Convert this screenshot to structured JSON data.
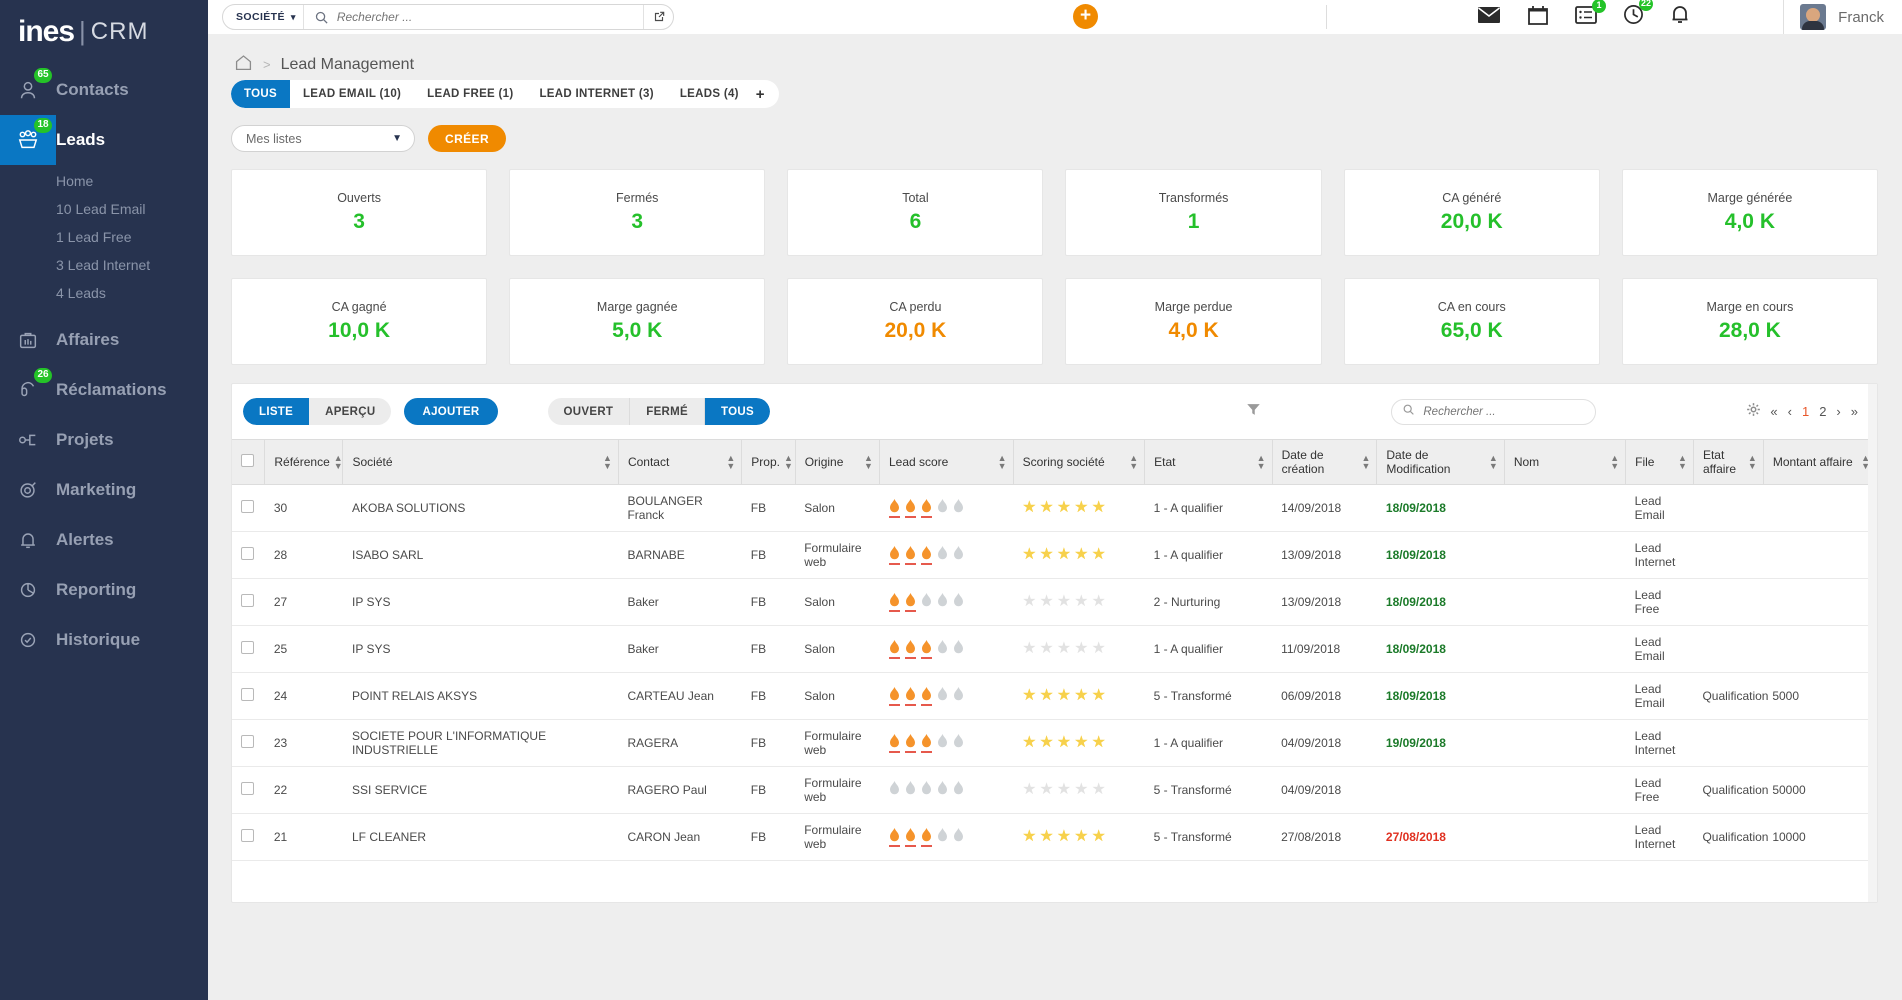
{
  "brand": {
    "name": "ines",
    "separator": "|",
    "suffix": "CRM"
  },
  "sidebar": {
    "items": [
      {
        "label": "Contacts",
        "icon": "person-icon",
        "badge": "65",
        "active": false
      },
      {
        "label": "Leads",
        "icon": "leads-icon",
        "badge": "18",
        "active": true
      },
      {
        "label": "Affaires",
        "icon": "briefcase-icon",
        "badge": "",
        "active": false
      },
      {
        "label": "Réclamations",
        "icon": "headset-icon",
        "badge": "26",
        "active": false
      },
      {
        "label": "Projets",
        "icon": "project-icon",
        "badge": "",
        "active": false
      },
      {
        "label": "Marketing",
        "icon": "target-icon",
        "badge": "",
        "active": false
      },
      {
        "label": "Alertes",
        "icon": "bell-icon",
        "badge": "",
        "active": false
      },
      {
        "label": "Reporting",
        "icon": "piechart-icon",
        "badge": "",
        "active": false
      },
      {
        "label": "Historique",
        "icon": "history-icon",
        "badge": "",
        "active": false
      }
    ],
    "subnav": [
      "Home",
      "10 Lead Email",
      "1 Lead Free",
      "3 Lead Internet",
      "4 Leads"
    ]
  },
  "topbar": {
    "search_scope": "SOCIÉTÉ",
    "search_placeholder": "Rechercher ...",
    "search_value": "",
    "search_icon": "search-icon",
    "external_link_icon": "external-link-icon",
    "add_button_icon": "plus-icon",
    "icons": [
      {
        "name": "mail-icon",
        "badge": ""
      },
      {
        "name": "calendar-icon",
        "badge": ""
      },
      {
        "name": "tasks-icon",
        "badge": "1"
      },
      {
        "name": "clock-icon",
        "badge": "22"
      },
      {
        "name": "bell-icon",
        "badge": ""
      }
    ],
    "user_name": "Franck",
    "avatar": "user-avatar"
  },
  "breadcrumb": {
    "home_icon": "home-icon",
    "separator": ">",
    "title": "Lead Management"
  },
  "tabs": [
    {
      "label": "TOUS",
      "active": true
    },
    {
      "label": "LEAD EMAIL (10)",
      "active": false
    },
    {
      "label": "LEAD FREE (1)",
      "active": false
    },
    {
      "label": "LEAD INTERNET (3)",
      "active": false
    },
    {
      "label": "LEADS (4)",
      "active": false
    }
  ],
  "tab_add_icon": "plus-icon",
  "listbar": {
    "select_value": "Mes listes",
    "select_caret_icon": "chevron-down-icon",
    "create_label": "CRÉER"
  },
  "kpis": [
    {
      "label": "Ouverts",
      "value": "3",
      "color": "green"
    },
    {
      "label": "Fermés",
      "value": "3",
      "color": "green"
    },
    {
      "label": "Total",
      "value": "6",
      "color": "green"
    },
    {
      "label": "Transformés",
      "value": "1",
      "color": "green"
    },
    {
      "label": "CA généré",
      "value": "20,0 K",
      "color": "green"
    },
    {
      "label": "Marge générée",
      "value": "4,0 K",
      "color": "green"
    },
    {
      "label": "CA gagné",
      "value": "10,0 K",
      "color": "green"
    },
    {
      "label": "Marge gagnée",
      "value": "5,0 K",
      "color": "green"
    },
    {
      "label": "CA perdu",
      "value": "20,0 K",
      "color": "orange"
    },
    {
      "label": "Marge perdue",
      "value": "4,0 K",
      "color": "orange"
    },
    {
      "label": "CA en cours",
      "value": "65,0 K",
      "color": "green"
    },
    {
      "label": "Marge en cours",
      "value": "28,0 K",
      "color": "green"
    }
  ],
  "panel_toolbar": {
    "view_modes": [
      {
        "label": "LISTE",
        "active": true
      },
      {
        "label": "APERÇU",
        "active": false
      }
    ],
    "add_label": "AJOUTER",
    "status_filters": [
      {
        "label": "OUVERT",
        "active": false
      },
      {
        "label": "FERMÉ",
        "active": false
      },
      {
        "label": "TOUS",
        "active": true
      }
    ],
    "filter_icon": "funnel-icon",
    "search_icon": "search-icon",
    "search_placeholder": "Rechercher ...",
    "search_value": "",
    "gear_icon": "gear-icon",
    "pagination": {
      "first": "«",
      "prev": "‹",
      "pages": [
        "1",
        "2"
      ],
      "current": "1",
      "next": "›",
      "last": "»"
    }
  },
  "table": {
    "select_all_checkbox": false,
    "columns": [
      {
        "label": "Référence",
        "sortable": true
      },
      {
        "label": "Société",
        "sortable": true
      },
      {
        "label": "Contact",
        "sortable": true
      },
      {
        "label": "Prop.",
        "sortable": true
      },
      {
        "label": "Origine",
        "sortable": true
      },
      {
        "label": "Lead score",
        "sortable": true
      },
      {
        "label": "Scoring société",
        "sortable": true
      },
      {
        "label": "Etat",
        "sortable": true
      },
      {
        "label": "Date de création",
        "sortable": true
      },
      {
        "label": "Date de Modification",
        "sortable": true
      },
      {
        "label": "Nom",
        "sortable": true
      },
      {
        "label": "File",
        "sortable": true
      },
      {
        "label": "Etat affaire",
        "sortable": true
      },
      {
        "label": "Montant affaire",
        "sortable": true
      }
    ],
    "rows": [
      {
        "reference": "30",
        "societe": "AKOBA SOLUTIONS",
        "contact": "BOULANGER Franck",
        "prop": "FB",
        "origine": "Salon",
        "lead_score": 3,
        "scoring_societe": 5,
        "etat": "1 - A qualifier",
        "date_creation": "14/09/2018",
        "date_modification": "18/09/2018",
        "date_modification_color": "green",
        "nom": "",
        "file": "Lead Email",
        "etat_affaire": "",
        "montant_affaire": ""
      },
      {
        "reference": "28",
        "societe": "ISABO SARL",
        "contact": "BARNABE",
        "prop": "FB",
        "origine": "Formulaire web",
        "lead_score": 3,
        "scoring_societe": 5,
        "etat": "1 - A qualifier",
        "date_creation": "13/09/2018",
        "date_modification": "18/09/2018",
        "date_modification_color": "green",
        "nom": "",
        "file": "Lead Internet",
        "etat_affaire": "",
        "montant_affaire": ""
      },
      {
        "reference": "27",
        "societe": "IP SYS",
        "contact": "Baker",
        "prop": "FB",
        "origine": "Salon",
        "lead_score": 2,
        "scoring_societe": 0,
        "etat": "2 - Nurturing",
        "date_creation": "13/09/2018",
        "date_modification": "18/09/2018",
        "date_modification_color": "green",
        "nom": "",
        "file": "Lead Free",
        "etat_affaire": "",
        "montant_affaire": ""
      },
      {
        "reference": "25",
        "societe": "IP SYS",
        "contact": "Baker",
        "prop": "FB",
        "origine": "Salon",
        "lead_score": 3,
        "scoring_societe": 0,
        "etat": "1 - A qualifier",
        "date_creation": "11/09/2018",
        "date_modification": "18/09/2018",
        "date_modification_color": "green",
        "nom": "",
        "file": "Lead Email",
        "etat_affaire": "",
        "montant_affaire": ""
      },
      {
        "reference": "24",
        "societe": "POINT RELAIS AKSYS",
        "contact": "CARTEAU Jean",
        "prop": "FB",
        "origine": "Salon",
        "lead_score": 3,
        "scoring_societe": 5,
        "etat": "5 - Transformé",
        "date_creation": "06/09/2018",
        "date_modification": "18/09/2018",
        "date_modification_color": "green",
        "nom": "",
        "file": "Lead Email",
        "etat_affaire": "Qualification",
        "montant_affaire": "5000"
      },
      {
        "reference": "23",
        "societe": "SOCIETE POUR L'INFORMATIQUE INDUSTRIELLE",
        "contact": "RAGERA",
        "prop": "FB",
        "origine": "Formulaire web",
        "lead_score": 3,
        "scoring_societe": 5,
        "etat": "1 - A qualifier",
        "date_creation": "04/09/2018",
        "date_modification": "19/09/2018",
        "date_modification_color": "green",
        "nom": "",
        "file": "Lead Internet",
        "etat_affaire": "",
        "montant_affaire": ""
      },
      {
        "reference": "22",
        "societe": "SSI SERVICE",
        "contact": "RAGERO Paul",
        "prop": "FB",
        "origine": "Formulaire web",
        "lead_score": 0,
        "scoring_societe": 0,
        "etat": "5 - Transformé",
        "date_creation": "04/09/2018",
        "date_modification": "",
        "date_modification_color": "green",
        "nom": "",
        "file": "Lead Free",
        "etat_affaire": "Qualification",
        "montant_affaire": "50000"
      },
      {
        "reference": "21",
        "societe": "LF CLEANER",
        "contact": "CARON Jean",
        "prop": "FB",
        "origine": "Formulaire web",
        "lead_score": 3,
        "scoring_societe": 5,
        "etat": "5 - Transformé",
        "date_creation": "27/08/2018",
        "date_modification": "27/08/2018",
        "date_modification_color": "red",
        "nom": "",
        "file": "Lead Internet",
        "etat_affaire": "Qualification",
        "montant_affaire": "10000"
      }
    ]
  },
  "colors": {
    "sidebar_bg": "#27334f",
    "accent_blue": "#0a77c3",
    "accent_orange": "#f08a00",
    "green": "#25c02b",
    "badge_green": "#24c328",
    "red": "#e03020"
  }
}
